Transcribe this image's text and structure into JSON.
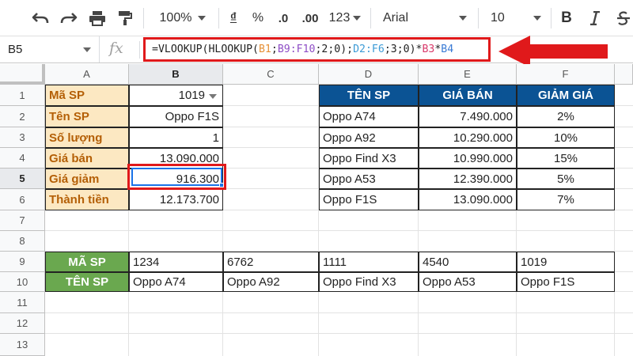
{
  "toolbar": {
    "zoom": "100%",
    "currency": "₫",
    "percent": "%",
    "dec_less": ".0",
    "dec_more": ".00",
    "more_formats": "123",
    "font": "Arial",
    "font_size": "10",
    "bold": "B"
  },
  "formula_bar": {
    "name_box": "B5",
    "fx": "fx",
    "parts": [
      {
        "text": "=VLOOKUP(HLOOKUP(",
        "color": "#222222"
      },
      {
        "text": "B1",
        "color": "#e69138"
      },
      {
        "text": ";",
        "color": "#222222"
      },
      {
        "text": "B9:F10",
        "color": "#8e4ec6"
      },
      {
        "text": ";2;0);",
        "color": "#222222"
      },
      {
        "text": "D2:F6",
        "color": "#3d9bd6"
      },
      {
        "text": ";3;0)*",
        "color": "#222222"
      },
      {
        "text": "B3",
        "color": "#d93b6b"
      },
      {
        "text": "*",
        "color": "#222222"
      },
      {
        "text": "B4",
        "color": "#3a7bd5"
      }
    ]
  },
  "columns": [
    "A",
    "B",
    "C",
    "D",
    "E",
    "F"
  ],
  "rows": [
    "1",
    "2",
    "3",
    "4",
    "5",
    "6",
    "7",
    "8",
    "9",
    "10",
    "11",
    "12",
    "13"
  ],
  "input_block": {
    "labels": [
      "Mã SP",
      "Tên SP",
      "Số lượng",
      "Giá bán",
      "Giá giảm",
      "Thành tiền"
    ],
    "values": [
      "1019",
      "Oppo F1S",
      "1",
      "13.090.000",
      "916.300",
      "12.173.700"
    ]
  },
  "price_table": {
    "headers": [
      "TÊN SP",
      "GIÁ BÁN",
      "GIẢM GIÁ"
    ],
    "rows": [
      [
        "Oppo A74",
        "7.490.000",
        "2%"
      ],
      [
        "Oppo A92",
        "10.290.000",
        "10%"
      ],
      [
        "Oppo Find X3",
        "10.990.000",
        "15%"
      ],
      [
        "Oppo A53",
        "12.390.000",
        "5%"
      ],
      [
        "Oppo F1S",
        "13.090.000",
        "7%"
      ]
    ]
  },
  "lookup_table": {
    "row_labels": [
      "MÃ SP",
      "TÊN SP"
    ],
    "codes": [
      "1234",
      "6762",
      "1111",
      "4540",
      "1019"
    ],
    "names": [
      "Oppo A74",
      "Oppo A92",
      "Oppo Find X3",
      "Oppo A53",
      "Oppo F1S"
    ]
  },
  "colors": {
    "label_bg": "#fce8c2",
    "label_text": "#b45f06",
    "header_blue": "#0b5394",
    "header_green": "#6aa84f",
    "highlight_red": "#e0191b",
    "selection_blue": "#1a73e8"
  }
}
